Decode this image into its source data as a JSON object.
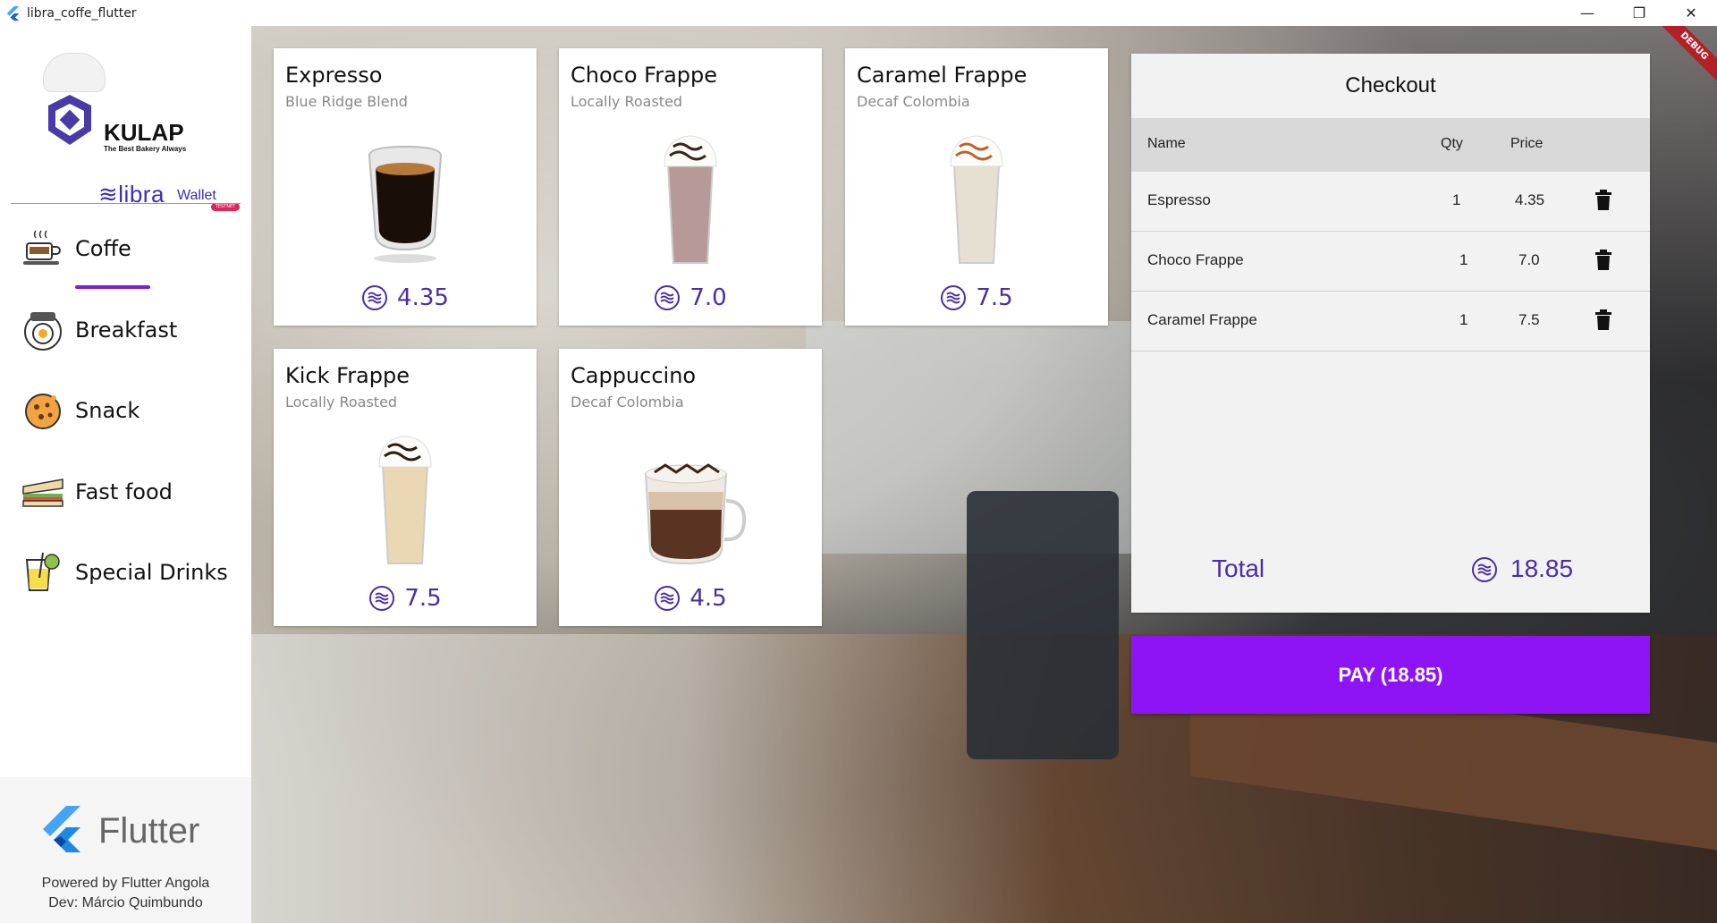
{
  "window": {
    "title": "libra_coffe_flutter",
    "controls": {
      "minimize": "—",
      "maximize": "❐",
      "close": "✕"
    }
  },
  "sidebar": {
    "brand": {
      "name": "KULAP",
      "tagline": "The Best Bakery Always",
      "libra": "≋libra",
      "wallet": "Wallet",
      "badge": "TESTNET"
    },
    "nav": [
      {
        "label": "Coffe",
        "icon": "coffee-cup-icon",
        "active": true
      },
      {
        "label": "Breakfast",
        "icon": "breakfast-egg-icon",
        "active": false
      },
      {
        "label": "Snack",
        "icon": "cookie-icon",
        "active": false
      },
      {
        "label": "Fast food",
        "icon": "sandwich-icon",
        "active": false
      },
      {
        "label": "Special Drinks",
        "icon": "lemonade-icon",
        "active": false
      }
    ],
    "footer": {
      "flutter": "Flutter",
      "powered": "Powered by Flutter Angola",
      "dev": "Dev: Márcio Quimbundo"
    }
  },
  "debug_banner": "DEBUG",
  "products": [
    {
      "name": "Expresso",
      "subtitle": "Blue Ridge Blend",
      "price": "4.35",
      "image": "espresso-glass"
    },
    {
      "name": "Choco Frappe",
      "subtitle": "Locally Roasted",
      "price": "7.0",
      "image": "choco-frappe"
    },
    {
      "name": "Caramel Frappe",
      "subtitle": "Decaf Colombia",
      "price": "7.5",
      "image": "caramel-frappe"
    },
    {
      "name": "Kick Frappe",
      "subtitle": "Locally Roasted",
      "price": "7.5",
      "image": "kick-frappe"
    },
    {
      "name": "Cappuccino",
      "subtitle": "Decaf Colombia",
      "price": "4.5",
      "image": "cappuccino-mug"
    }
  ],
  "checkout": {
    "title": "Checkout",
    "headers": {
      "name": "Name",
      "qty": "Qty",
      "price": "Price"
    },
    "items": [
      {
        "name": "Espresso",
        "qty": "1",
        "price": "4.35"
      },
      {
        "name": "Choco Frappe",
        "qty": "1",
        "price": "7.0"
      },
      {
        "name": "Caramel Frappe",
        "qty": "1",
        "price": "7.5"
      }
    ],
    "total_label": "Total",
    "total_value": "18.85"
  },
  "pay_button": "PAY (18.85)",
  "colors": {
    "accent": "#8e14f5",
    "price": "#4a2fa0",
    "nav_underline": "#7b1fd8"
  }
}
